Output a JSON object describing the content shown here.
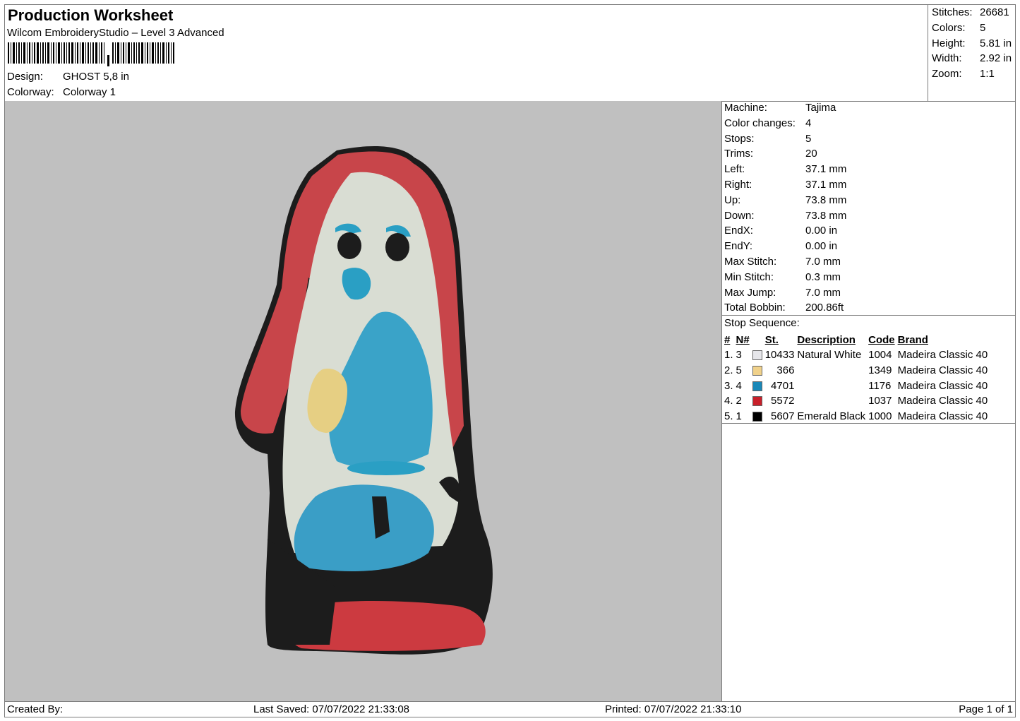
{
  "header": {
    "title": "Production Worksheet",
    "software": "Wilcom EmbroideryStudio – Level 3 Advanced",
    "design_label": "Design:",
    "design_value": "GHOST 5,8 in",
    "colorway_label": "Colorway:",
    "colorway_value": "Colorway 1"
  },
  "summary": {
    "stitches_label": "Stitches:",
    "stitches": "26681",
    "colors_label": "Colors:",
    "colors": "5",
    "height_label": "Height:",
    "height": "5.81 in",
    "width_label": "Width:",
    "width": "2.92 in",
    "zoom_label": "Zoom:",
    "zoom": "1:1"
  },
  "machine": [
    {
      "label": "Machine:",
      "value": "Tajima"
    },
    {
      "label": "Color changes:",
      "value": "4"
    },
    {
      "label": "Stops:",
      "value": "5"
    },
    {
      "label": "Trims:",
      "value": "20"
    },
    {
      "label": "Left:",
      "value": "37.1 mm"
    },
    {
      "label": "Right:",
      "value": "37.1 mm"
    },
    {
      "label": "Up:",
      "value": "73.8 mm"
    },
    {
      "label": "Down:",
      "value": "73.8 mm"
    },
    {
      "label": "EndX:",
      "value": "0.00 in"
    },
    {
      "label": "EndY:",
      "value": "0.00 in"
    },
    {
      "label": "Max Stitch:",
      "value": "7.0 mm"
    },
    {
      "label": "Min Stitch:",
      "value": "0.3 mm"
    },
    {
      "label": "Max Jump:",
      "value": "7.0 mm"
    },
    {
      "label": "Total Bobbin:",
      "value": "200.86ft"
    }
  ],
  "stop_sequence": {
    "label": "Stop Sequence:",
    "columns": [
      "#",
      "N#",
      "St.",
      "Description",
      "Code",
      "Brand"
    ],
    "rows": [
      {
        "idx": "1.",
        "n": "3",
        "color": "#e6e6ea",
        "st": "10433",
        "desc": "Natural White",
        "code": "1004",
        "brand": "Madeira Classic 40"
      },
      {
        "idx": "2.",
        "n": "5",
        "color": "#f0d18a",
        "st": "366",
        "desc": "",
        "code": "1349",
        "brand": "Madeira Classic 40"
      },
      {
        "idx": "3.",
        "n": "4",
        "color": "#1a88b8",
        "st": "4701",
        "desc": "",
        "code": "1176",
        "brand": "Madeira Classic 40"
      },
      {
        "idx": "4.",
        "n": "2",
        "color": "#c8202a",
        "st": "5572",
        "desc": "",
        "code": "1037",
        "brand": "Madeira Classic 40"
      },
      {
        "idx": "5.",
        "n": "1",
        "color": "#000000",
        "st": "5607",
        "desc": "Emerald Black",
        "code": "1000",
        "brand": "Madeira Classic 40"
      }
    ]
  },
  "footer": {
    "created_by": "Created By:",
    "last_saved": "Last Saved: 07/07/2022 21:33:08",
    "printed": "Printed: 07/07/2022 21:33:10",
    "page": "Page 1 of 1"
  }
}
